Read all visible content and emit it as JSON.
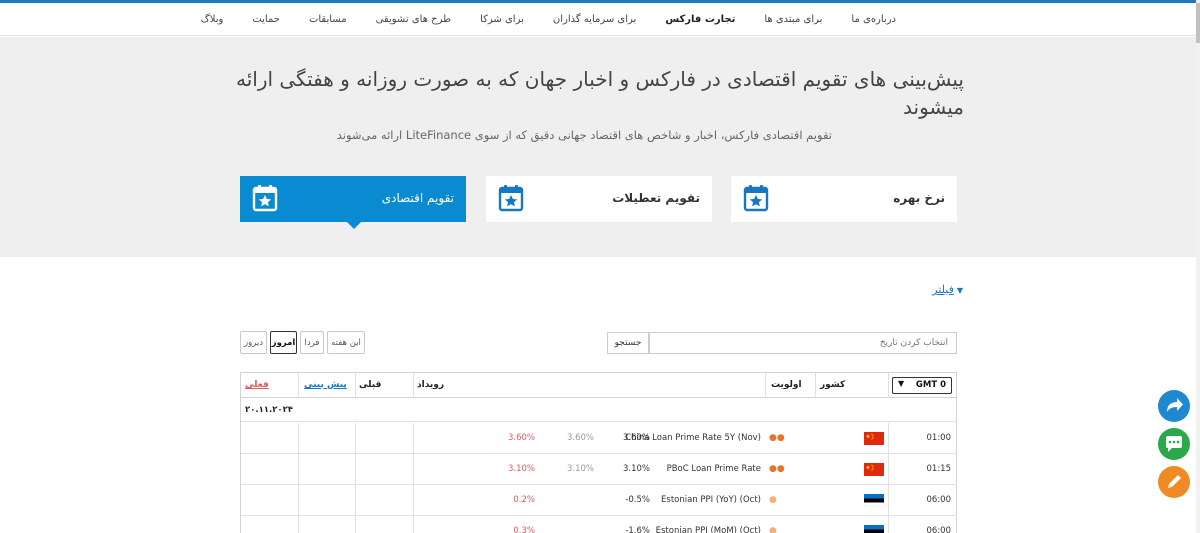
{
  "nav": {
    "items": [
      {
        "label": "درباره‌ی ما",
        "active": false
      },
      {
        "label": "برای مبتدی ها",
        "active": false
      },
      {
        "label": "تجارت فارکس",
        "active": true
      },
      {
        "label": "برای سرمایه گذاران",
        "active": false
      },
      {
        "label": "برای شرکا",
        "active": false
      },
      {
        "label": "طرح های تشویقی",
        "active": false
      },
      {
        "label": "مسابقات",
        "active": false
      },
      {
        "label": "حمایت",
        "active": false
      },
      {
        "label": "وبلاگ",
        "active": false
      }
    ]
  },
  "hero": {
    "title": "پیش‌بینی های تقویم اقتصادی در فارکس و اخبار جهان که به صورت روزانه و هفتگی ارائه میشوند",
    "subtitle": "تقویم اقتصادی فارکس، اخبار و شاخص های اقتصاد جهانی دقیق که از سوی LiteFinance ارائه می‌شوند"
  },
  "tabs": [
    {
      "label": "تقویم اقتصادی",
      "active": true,
      "icon": "calendar-star-icon"
    },
    {
      "label": "تقویم تعطیلات",
      "active": false,
      "icon": "calendar-star-icon"
    },
    {
      "label": "نرخ بهره",
      "active": false,
      "icon": "calendar-star-icon"
    }
  ],
  "filter": {
    "label": "فیلتر"
  },
  "period_buttons": [
    {
      "label": "دیروز",
      "active": false
    },
    {
      "label": "امروز",
      "active": true
    },
    {
      "label": "فردا",
      "active": false
    },
    {
      "label": "این هفته",
      "active": false
    }
  ],
  "search": {
    "button_label": "جستجو",
    "placeholder": "انتخاب کردن تاریخ"
  },
  "table": {
    "headers": {
      "timezone": "GMT 0",
      "country": "کشور",
      "importance": "اولویت",
      "event": "رویداد",
      "previous": "قبلی",
      "forecast": "پیش بینی",
      "actual": "فعلی"
    },
    "date": "۲۰.۱۱.۲۰۲۴",
    "rows": [
      {
        "time": "01:00",
        "country": "China",
        "importance": "●●",
        "level": "high",
        "event": "China Loan Prime Rate 5Y (Nov)",
        "previous": "3.60%",
        "forecast": "3.60%",
        "actual": "3.60%"
      },
      {
        "time": "01:15",
        "country": "China",
        "importance": "●●",
        "level": "high",
        "event": "PBoC Loan Prime Rate",
        "previous": "3.10%",
        "forecast": "3.10%",
        "actual": "3.10%"
      },
      {
        "time": "06:00",
        "country": "Estonia",
        "importance": "●",
        "level": "low",
        "event": "Estonian PPI (YoY) (Oct)",
        "previous": "-0.5%",
        "forecast": "",
        "actual": "0.2%"
      },
      {
        "time": "06:00",
        "country": "Estonia",
        "importance": "●",
        "level": "low",
        "event": "Estonian PPI (MoM) (Oct)",
        "previous": "-1.6%",
        "forecast": "",
        "actual": "0.3%"
      }
    ]
  },
  "colors": {
    "accent": "#0a8ad0",
    "share": "#1e88d0",
    "chat": "#2aa84a",
    "edit": "#f08a24",
    "actual_value": "#e05a5a"
  },
  "fabs": [
    {
      "icon": "share-arrow-icon"
    },
    {
      "icon": "chat-bubble-icon"
    },
    {
      "icon": "pencil-icon"
    }
  ]
}
